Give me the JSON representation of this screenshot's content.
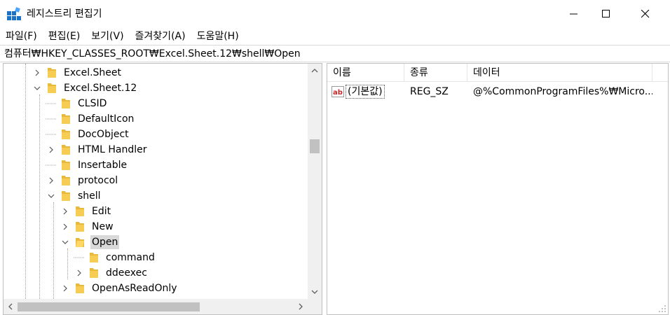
{
  "window": {
    "title": "레지스트리 편집기",
    "app_icon": "registry-editor-icon",
    "controls": [
      "minimize-icon",
      "maximize-icon",
      "close-icon"
    ]
  },
  "menu": {
    "file": "파일(F)",
    "edit": "편집(E)",
    "view": "보기(V)",
    "favorites": "즐겨찾기(A)",
    "help": "도움말(H)"
  },
  "address": {
    "path": "컴퓨터₩HKEY_CLASSES_ROOT₩Excel.Sheet.12₩shell₩Open"
  },
  "tree": {
    "items": [
      {
        "label": "Excel.Sheet",
        "expander": "collapsed"
      },
      {
        "label": "Excel.Sheet.12",
        "expander": "expanded"
      },
      {
        "label": "CLSID",
        "expander": "none"
      },
      {
        "label": "DefaultIcon",
        "expander": "none"
      },
      {
        "label": "DocObject",
        "expander": "none"
      },
      {
        "label": "HTML Handler",
        "expander": "collapsed"
      },
      {
        "label": "Insertable",
        "expander": "none"
      },
      {
        "label": "protocol",
        "expander": "collapsed"
      },
      {
        "label": "shell",
        "expander": "expanded"
      },
      {
        "label": "Edit",
        "expander": "collapsed"
      },
      {
        "label": "New",
        "expander": "collapsed"
      },
      {
        "label": "Open",
        "expander": "expanded",
        "selected": true
      },
      {
        "label": "command",
        "expander": "none"
      },
      {
        "label": "ddeexec",
        "expander": "collapsed"
      },
      {
        "label": "OpenAsReadOnly",
        "expander": "collapsed"
      }
    ],
    "folder_color": "#e8b93a"
  },
  "list": {
    "columns": {
      "name": "이름",
      "type": "종류",
      "data": "데이터"
    },
    "rows": [
      {
        "icon": "string-value-ab-icon",
        "name": "(기본값)",
        "type": "REG_SZ",
        "data": "@%CommonProgramFiles%₩Micro..."
      }
    ]
  }
}
